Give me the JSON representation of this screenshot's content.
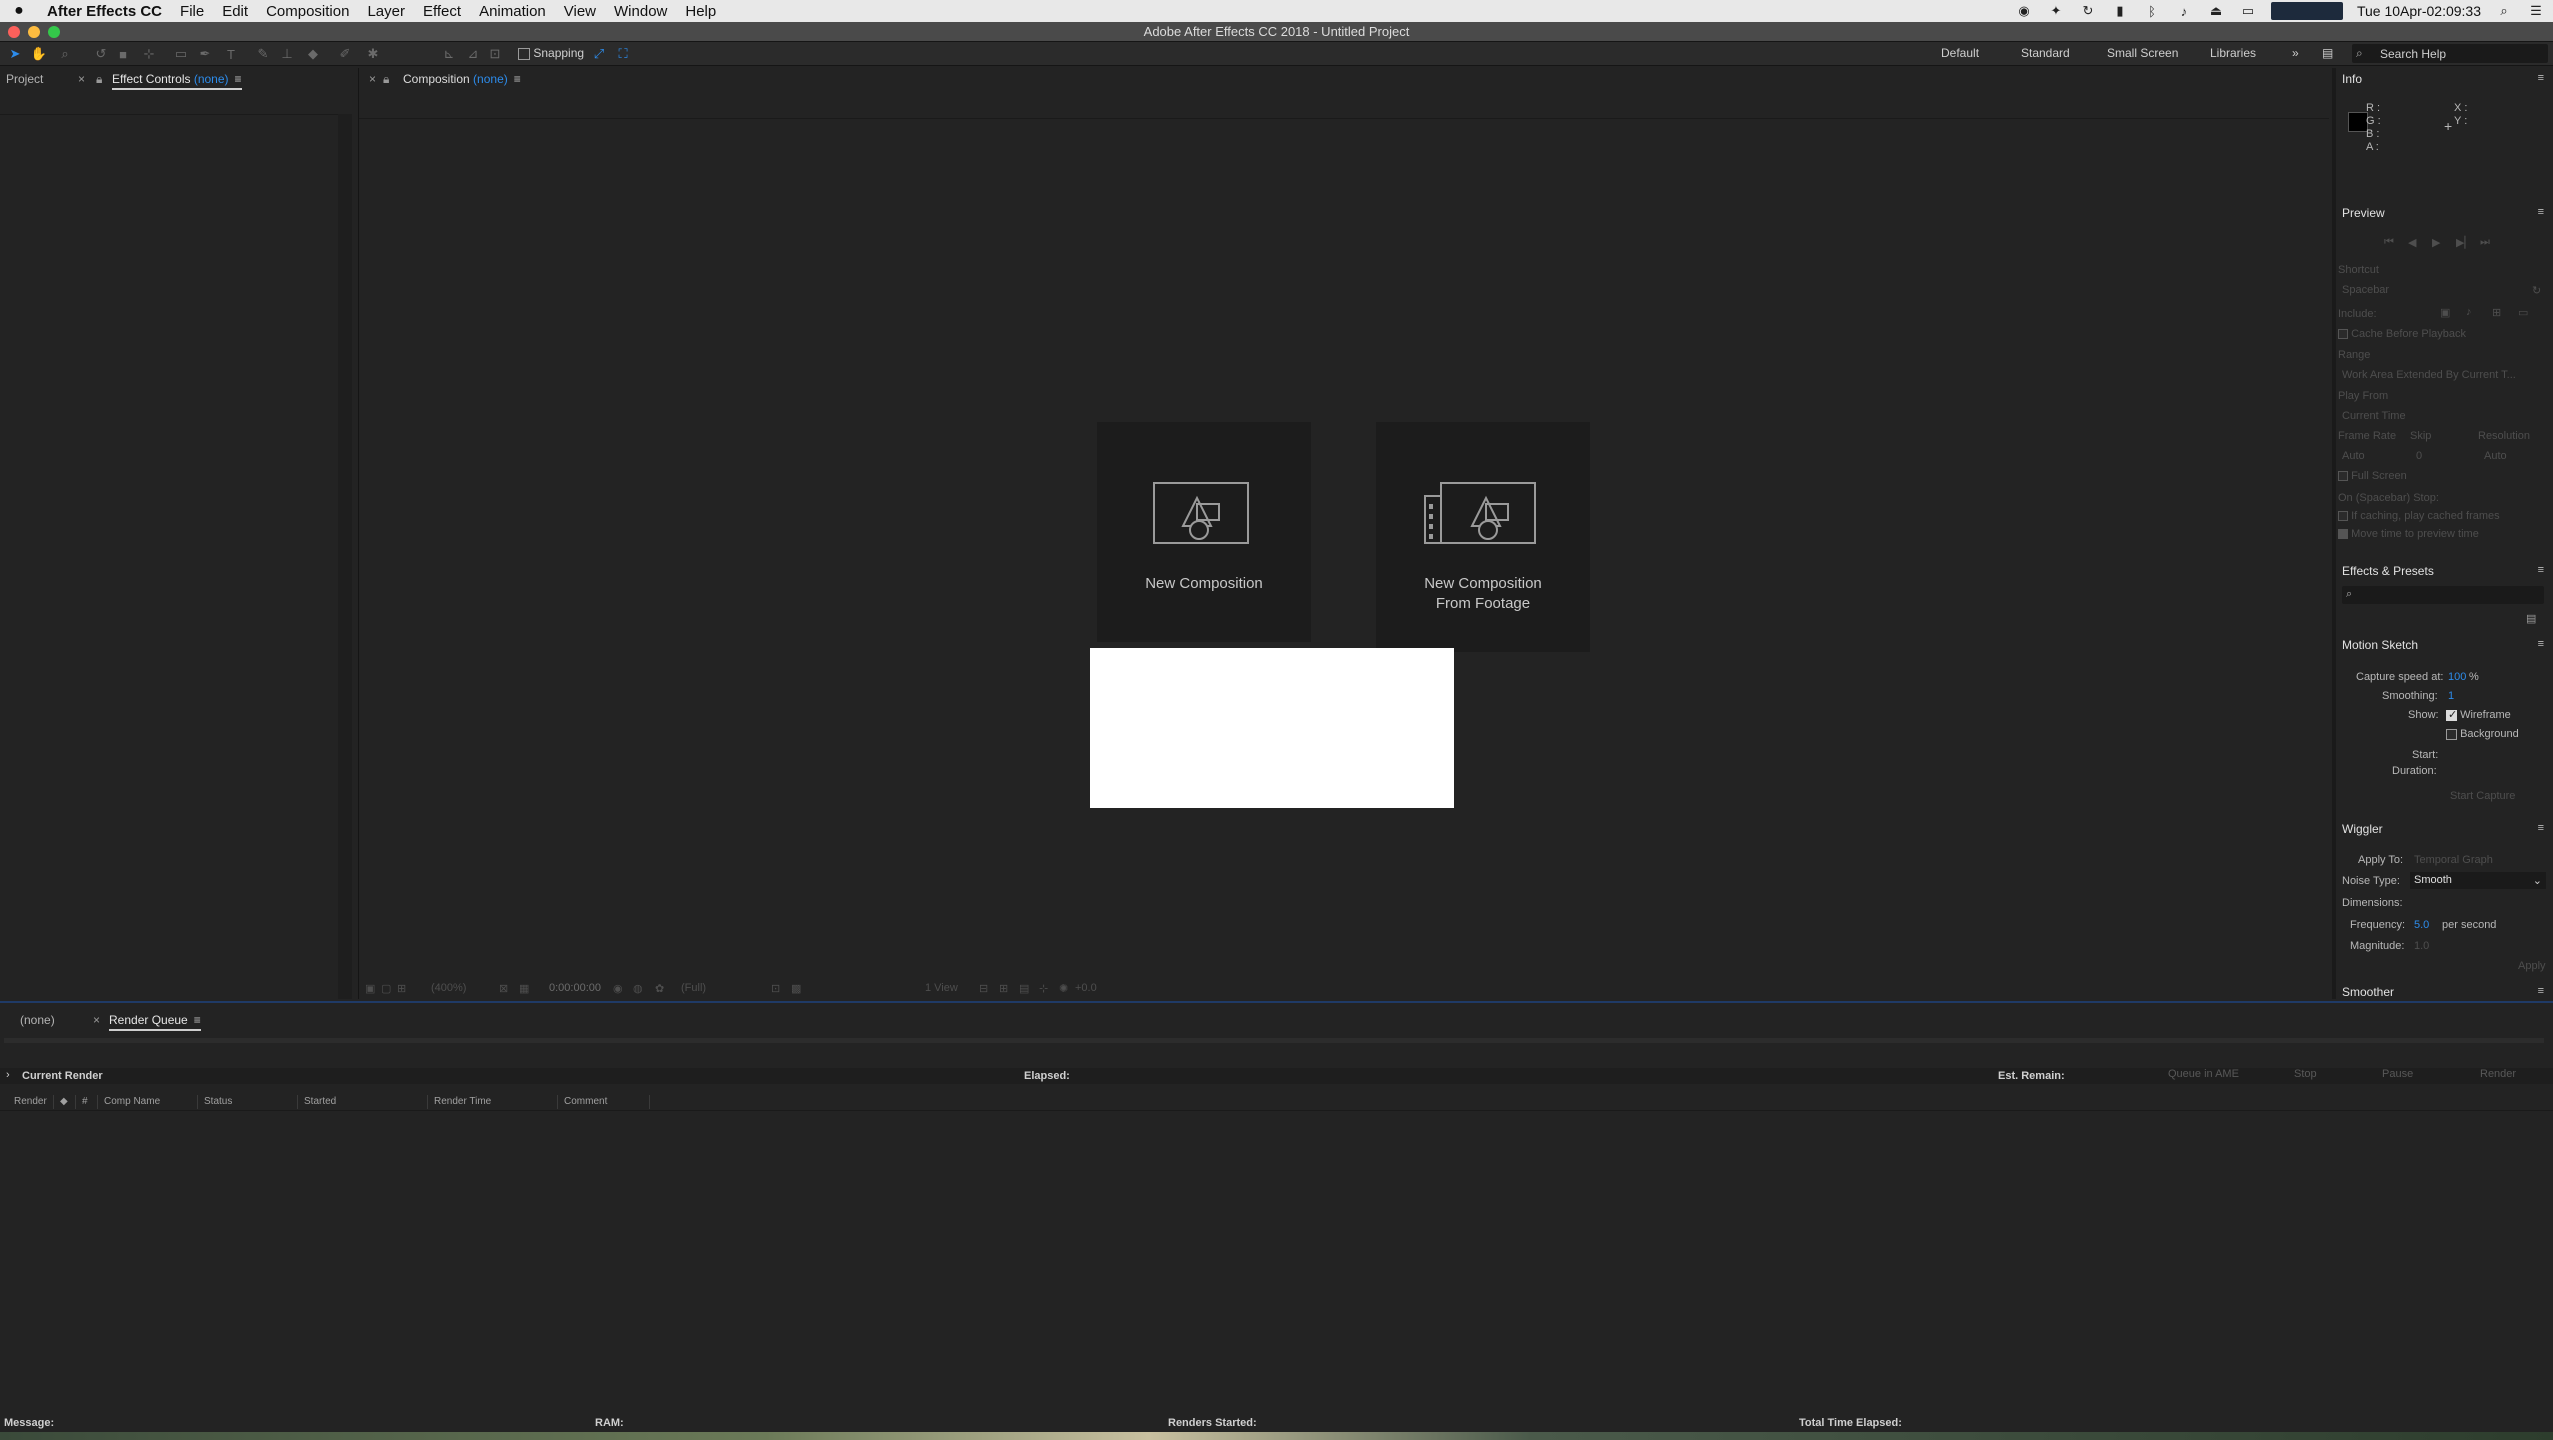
{
  "macos_menubar": {
    "app": "After Effects CC",
    "menus": [
      "File",
      "Edit",
      "Composition",
      "Layer",
      "Effect",
      "Animation",
      "View",
      "Window",
      "Help"
    ],
    "clock": "Tue 10Apr-02:09:33"
  },
  "window": {
    "title": "Adobe After Effects CC 2018 - Untitled Project"
  },
  "toolbar": {
    "snapping_label": "Snapping",
    "workspaces": [
      "Default",
      "Standard",
      "Small Screen",
      "Libraries"
    ],
    "search_placeholder": "Search Help"
  },
  "left_panel": {
    "tab_project": "Project",
    "tab_effect_controls": "Effect Controls",
    "tab_effect_controls_target": "(none)"
  },
  "composition_panel": {
    "tab_label": "Composition",
    "tab_target": "(none)",
    "new_comp": "New Composition",
    "new_comp_from_footage_1": "New Composition",
    "new_comp_from_footage_2": "From Footage",
    "footer": {
      "zoom": "(400%)",
      "timecode": "0:00:00:00",
      "resolution": "(Full)",
      "views": "1 View",
      "exposure": "+0.0"
    }
  },
  "info_panel": {
    "title": "Info",
    "r": "R :",
    "g": "G :",
    "b": "B :",
    "a": "A :",
    "x": "X :",
    "y": "Y :"
  },
  "preview_panel": {
    "title": "Preview",
    "shortcut_label": "Shortcut",
    "shortcut_value": "Spacebar",
    "include_label": "Include:",
    "cache_before_playback": "Cache Before Playback",
    "range_label": "Range",
    "range_value": "Work Area Extended By Current T...",
    "play_from_label": "Play From",
    "play_from_value": "Current Time",
    "frame_rate_label": "Frame Rate",
    "skip_label": "Skip",
    "resolution_label": "Resolution",
    "frame_rate_value": "Auto",
    "skip_value": "0",
    "resolution_value": "Auto",
    "full_screen": "Full Screen",
    "on_stop_label": "On (Spacebar) Stop:",
    "if_caching": "If caching, play cached frames",
    "move_time": "Move time to preview time"
  },
  "effects_presets": {
    "title": "Effects & Presets"
  },
  "motion_sketch": {
    "title": "Motion Sketch",
    "capture_speed_label": "Capture speed at:",
    "capture_speed_value": "100",
    "capture_speed_unit": "%",
    "smoothing_label": "Smoothing:",
    "smoothing_value": "1",
    "show_label": "Show:",
    "wireframe": "Wireframe",
    "background": "Background",
    "start_label": "Start:",
    "duration_label": "Duration:",
    "start_capture": "Start Capture"
  },
  "wiggler": {
    "title": "Wiggler",
    "apply_to_label": "Apply To:",
    "apply_to_value": "Temporal Graph",
    "noise_type_label": "Noise Type:",
    "noise_type_value": "Smooth",
    "dimensions_label": "Dimensions:",
    "frequency_label": "Frequency:",
    "frequency_value": "5.0",
    "frequency_unit": "per second",
    "magnitude_label": "Magnitude:",
    "magnitude_value": "1.0",
    "apply": "Apply"
  },
  "smoother": {
    "title": "Smoother"
  },
  "bottom_tabs": {
    "none_tab": "(none)",
    "render_queue_tab": "Render Queue"
  },
  "render_queue": {
    "current_render": "Current Render",
    "elapsed": "Elapsed:",
    "est_remain": "Est. Remain:",
    "buttons": {
      "queue_in_ame": "Queue in AME",
      "stop": "Stop",
      "pause": "Pause",
      "render": "Render"
    },
    "columns": [
      "Render",
      "#",
      "Comp Name",
      "Status",
      "Started",
      "Render Time",
      "Comment"
    ]
  },
  "status_bar": {
    "message": "Message:",
    "ram": "RAM:",
    "renders_started": "Renders Started:",
    "total_time_elapsed": "Total Time Elapsed:"
  }
}
